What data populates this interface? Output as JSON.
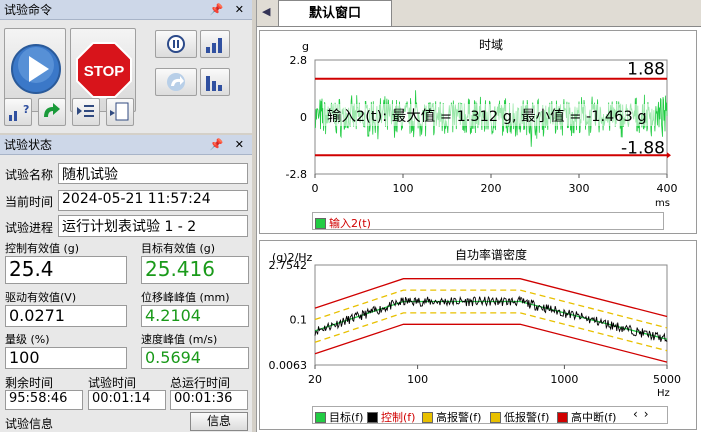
{
  "panels": {
    "command_title": "试验命令",
    "status_title": "试验状态",
    "panel_controls": "📌 ✕"
  },
  "tab": {
    "label": "默认窗口"
  },
  "status": {
    "name_label": "试验名称",
    "name_value": "随机试验",
    "time_label": "当前时间",
    "time_value": "2024-05-21 11:57:24",
    "progress_label": "试验进程",
    "progress_value": "运行计划表试验 1 - 2",
    "ctrl_rms_label": "控制有效值 (g)",
    "ctrl_rms_value": "25.4",
    "target_rms_label": "目标有效值 (g)",
    "target_rms_value": "25.416",
    "drive_rms_label": "驱动有效值(V)",
    "drive_rms_value": "0.0271",
    "disp_label": "位移峰峰值 (mm)",
    "disp_value": "4.2104",
    "level_label": "量级 (%)",
    "level_value": "100",
    "vel_label": "速度峰值 (m/s)",
    "vel_value": "0.5694",
    "remain_label": "剩余时间",
    "remain_value": "95:58:46",
    "test_time_label": "试验时间",
    "test_time_value": "00:01:14",
    "total_label": "总运行时间",
    "total_value": "00:01:36",
    "info_label": "试验信息",
    "info_button": "信息"
  },
  "buttons": {
    "stop_label": "STOP"
  },
  "colors": {
    "accent": "#1a9a1a",
    "limit": "#d00000",
    "warn": "#e8c000",
    "signal": "#22cc44"
  },
  "chart_data": [
    {
      "type": "line",
      "title": "时域",
      "ylabel": "g",
      "xlabel": "ms",
      "xlim": [
        0,
        400
      ],
      "ylim": [
        -2.8,
        2.8
      ],
      "xticks": [
        "0",
        "100",
        "200",
        "300",
        "400"
      ],
      "yticks": [
        "2.8",
        "0",
        "-2.8"
      ],
      "upper_limit": 1.88,
      "lower_limit": -1.88,
      "upper_label": "1.88",
      "lower_label": "-1.88",
      "annotation": "输入2(t): 最大值 = 1.312 g, 最小值 = -1.463 g",
      "series": [
        {
          "name": "输入2(t)",
          "max": 1.312,
          "min": -1.463
        }
      ]
    },
    {
      "type": "line",
      "title": "自功率谱密度",
      "ylabel": "(g)2/Hz",
      "xlabel": "Hz",
      "xscale": "log",
      "yscale": "log",
      "xlim": [
        20,
        5000
      ],
      "ylim": [
        0.0063,
        2.7542
      ],
      "xticks": [
        "20",
        "100",
        "1000",
        "5000"
      ],
      "yticks": [
        "2.7542",
        "0.1",
        "0.0063"
      ],
      "profile": {
        "x": [
          20,
          80,
          500,
          5000
        ],
        "y": [
          0.05,
          0.3,
          0.3,
          0.03
        ]
      },
      "series": [
        {
          "name": "目标(f)"
        },
        {
          "name": "控制(f)"
        },
        {
          "name": "高报警(f)"
        },
        {
          "name": "低报警(f)"
        },
        {
          "name": "高中断(f)"
        }
      ]
    }
  ]
}
